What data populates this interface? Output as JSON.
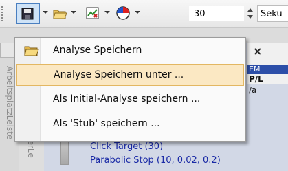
{
  "toolbar": {
    "zoom_value": "30",
    "unit_text": "Seku"
  },
  "background": {
    "left_panel_text_1": "ArbeitsplatzLeiste",
    "left_panel_text_2": "nerLe",
    "tree_items": [
      "Click Target  (30)",
      "Parabolic Stop  (10, 0.02, 0.2)"
    ],
    "right_panel": {
      "close_glyph": "×",
      "bar_text": "EM",
      "line1": "P/L",
      "line2": "/a"
    }
  },
  "menu": {
    "items": [
      {
        "label": "Analyse Speichern",
        "icon": "open-folder-icon",
        "highlighted": false
      },
      {
        "label": "Analyse Speichern unter ...",
        "icon": null,
        "highlighted": true
      },
      {
        "label": "Als Initial-Analyse speichern ...",
        "icon": null,
        "highlighted": false
      },
      {
        "label": "Als 'Stub' speichern ...",
        "icon": null,
        "highlighted": false
      }
    ]
  },
  "colors": {
    "menu_highlight": "#fbe8c3",
    "menu_highlight_border": "#e3b762",
    "tree_text": "#1a2aa6",
    "toolbar_pressed": "#cfe3f7"
  }
}
